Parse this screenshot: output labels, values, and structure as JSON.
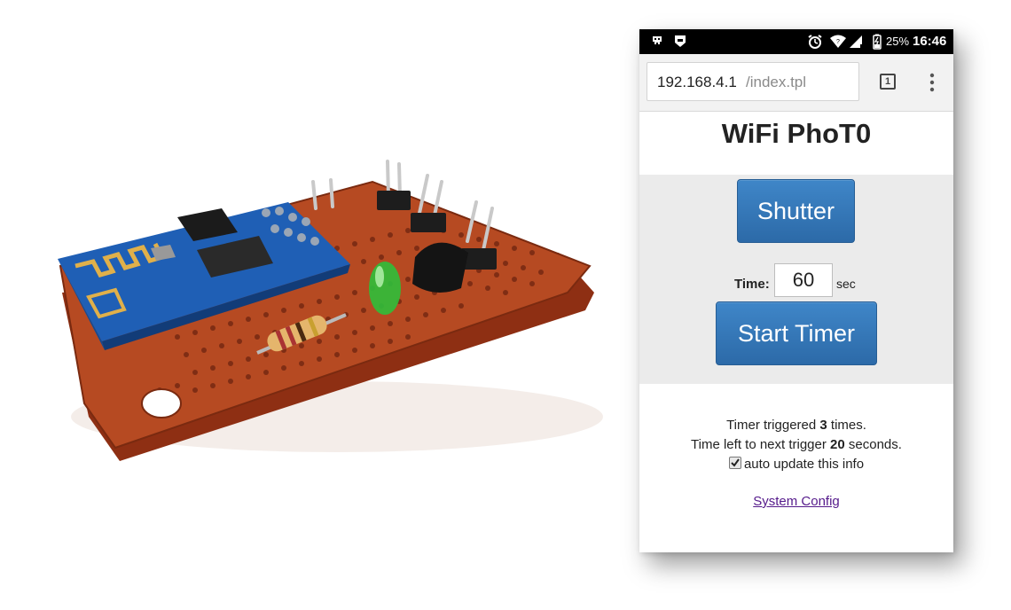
{
  "statusbar": {
    "icons": [
      "app-alien-icon",
      "app-shield-icon",
      "alarm-clock-icon",
      "wifi-signal-icon",
      "cell-signal-icon",
      "battery-icon"
    ],
    "battery_pct": "25%",
    "time": "16:46"
  },
  "browser": {
    "url_host": "192.168.4.1",
    "url_path": "/index.tpl",
    "tab_count": "1",
    "menu_icon": "overflow-menu-icon"
  },
  "page": {
    "title": "WiFi PhoT0",
    "shutter_label": "Shutter",
    "time_label": "Time:",
    "time_value": "60",
    "time_unit": "sec",
    "start_timer_label": "Start Timer",
    "info": {
      "triggered_prefix": "Timer triggered ",
      "triggered_count": "3",
      "triggered_suffix": " times.",
      "next_prefix": "Time left to next trigger ",
      "next_seconds": "20",
      "next_suffix": " seconds.",
      "auto_update_label": "auto update this info",
      "auto_update_checked": true
    },
    "system_config_link": "System Config"
  },
  "colors": {
    "button_blue": "#337ab7",
    "controls_bg": "#ebebeb",
    "link_visited": "#551a8b"
  }
}
